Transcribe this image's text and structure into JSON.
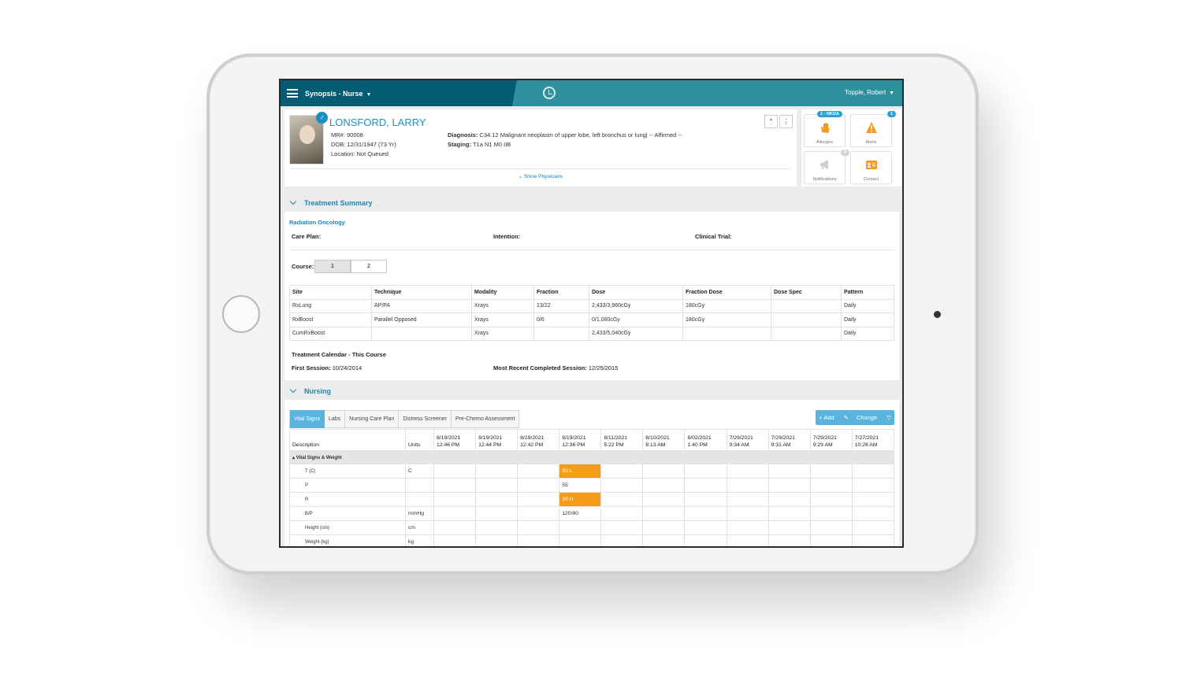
{
  "topbar": {
    "app_title": "Synopsis - Nurse",
    "user": "Topple, Robert",
    "history_icon": "history-icon"
  },
  "patient": {
    "name": "LONSFORD, LARRY",
    "gender_symbol": "♂",
    "mrn": "MR#: 90008",
    "dob": "DOB: 12/31/1947 (73 Yr)",
    "location": "Location: Not Queued",
    "diagnosis_label": "Diagnosis:",
    "diagnosis": " C34.12 Malignant neoplasm of upper lobe, left bronchus or lung| -- Affirmed --",
    "staging_label": "Staging:",
    "staging": " T1a N1 M0 IIB",
    "show_physicians": "Show Physicians"
  },
  "quick": {
    "allergies_badge": "1 - NKDA",
    "allergies": "Allergies",
    "alerts_badge": "1",
    "alerts": "Alerts",
    "notifications_badge": "0",
    "notifications": "Notifications",
    "contact": "Contact"
  },
  "treatment": {
    "title": "Treatment Summary",
    "dept": "Radiation Oncology",
    "care_plan": "Care Plan:",
    "intention": "Intention:",
    "clinical_trial": "Clinical Trial:",
    "course_label": "Course:",
    "courses": [
      "1",
      "2"
    ],
    "columns": [
      "Site",
      "Technique",
      "Modality",
      "Fraction",
      "Dose",
      "Fraction Dose",
      "Dose Spec",
      "Pattern"
    ],
    "rows": [
      [
        "RxLung",
        "AP/PA",
        "Xrays",
        "13/22",
        "2,433/3,960cGy",
        "180cGy",
        "",
        "Daily"
      ],
      [
        "RxBoost",
        "Parallel Opposed",
        "Xrays",
        "0/6",
        "0/1,080cGy",
        "180cGy",
        "",
        "Daily"
      ],
      [
        "CumRxBoost",
        "",
        "Xrays",
        "",
        "2,433/5,040cGy",
        "",
        "",
        "Daily"
      ]
    ],
    "calendar_title": "Treatment Calendar - This Course",
    "first_session": "First Session:",
    "first_session_value": " 10/24/2014",
    "recent_session": "Most Recent Completed Session:",
    "recent_session_value": " 12/25/2015"
  },
  "nursing": {
    "title": "Nursing",
    "tabs": [
      "Vital Signs",
      "Labs",
      "Nursing Care Plan",
      "Distress Screener",
      "Pre-Chemo Assessment"
    ],
    "add": "+ Add",
    "change": "Change",
    "col_desc": "Description",
    "col_units": "Units",
    "dates": [
      [
        "8/19/2021",
        "12:46 PM"
      ],
      [
        "8/19/2021",
        "12:44 PM"
      ],
      [
        "8/19/2021",
        "12:42 PM"
      ],
      [
        "8/19/2021",
        "12:36 PM"
      ],
      [
        "8/11/2021",
        "5:22 PM"
      ],
      [
        "8/10/2021",
        "8:13 AM"
      ],
      [
        "8/02/2021",
        "1:40 PM"
      ],
      [
        "7/29/2021",
        "9:34 AM"
      ],
      [
        "7/29/2021",
        "9:31 AM"
      ],
      [
        "7/29/2021",
        "9:29 AM"
      ],
      [
        "7/27/2021",
        "10:26 AM"
      ]
    ],
    "group": "▴ Vital Signs & Weight",
    "rows": [
      {
        "desc": "T (C)",
        "units": "C",
        "value": "33 L",
        "flag": "orange"
      },
      {
        "desc": "P",
        "units": "",
        "value": "55",
        "flag": ""
      },
      {
        "desc": "R",
        "units": "",
        "value": "26 H",
        "flag": "orange"
      },
      {
        "desc": "B/P",
        "units": "mmHg",
        "value": "120/80",
        "flag": ""
      },
      {
        "desc": "Height (cm)",
        "units": "cm",
        "value": "",
        "flag": ""
      },
      {
        "desc": "Weight (kg)",
        "units": "kg",
        "value": "",
        "flag": ""
      }
    ]
  }
}
